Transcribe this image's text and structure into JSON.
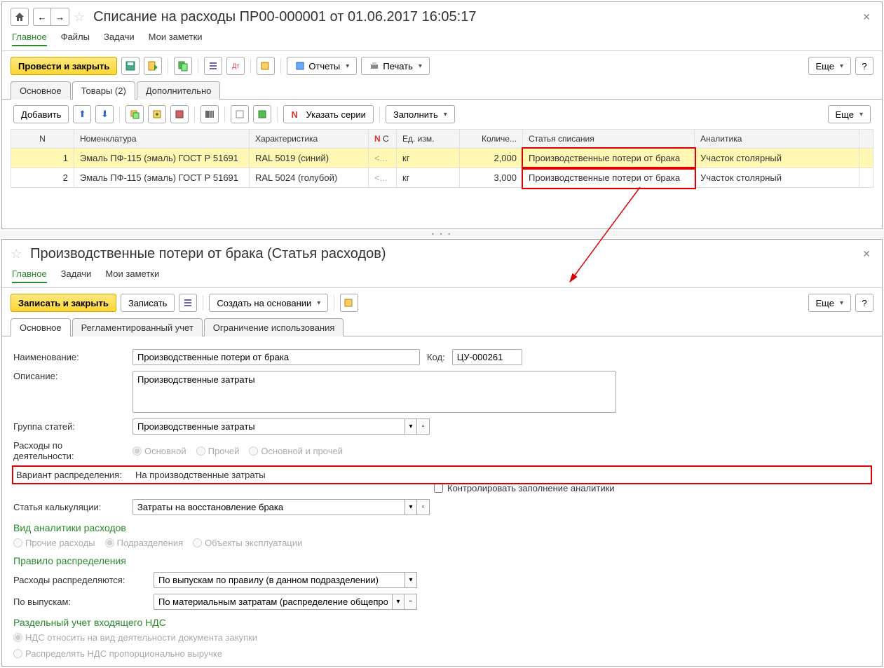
{
  "pane1": {
    "title": "Списание на расходы ПР00-000001 от 01.06.2017 16:05:17",
    "nav": [
      "Главное",
      "Файлы",
      "Задачи",
      "Мои заметки"
    ],
    "toolbar": {
      "post_close": "Провести и закрыть",
      "reports": "Отчеты",
      "print": "Печать",
      "more": "Еще"
    },
    "sub_tabs": [
      "Основное",
      "Товары (2)",
      "Дополнительно"
    ],
    "grid_toolbar": {
      "add": "Добавить",
      "series": "Указать серии",
      "fill": "Заполнить",
      "more": "Еще"
    },
    "table": {
      "headers": [
        "N",
        "Номенклатура",
        "Характеристика",
        "С",
        "Ед. изм.",
        "Количе...",
        "Статья списания",
        "Аналитика"
      ],
      "rows": [
        {
          "n": "1",
          "nom": "Эмаль ПФ-115 (эмаль) ГОСТ Р 51691",
          "char": "RAL 5019 (синий)",
          "c": "<...",
          "unit": "кг",
          "qty": "2,000",
          "article": "Производственные потери от брака",
          "anal": "Участок столярный"
        },
        {
          "n": "2",
          "nom": "Эмаль ПФ-115 (эмаль) ГОСТ Р 51691",
          "char": "RAL 5024 (голубой)",
          "c": "<...",
          "unit": "кг",
          "qty": "3,000",
          "article": "Производственные потери от брака",
          "anal": "Участок столярный"
        }
      ]
    }
  },
  "pane2": {
    "title": "Производственные потери от брака (Статья расходов)",
    "nav": [
      "Главное",
      "Задачи",
      "Мои заметки"
    ],
    "toolbar": {
      "save_close": "Записать и закрыть",
      "save": "Записать",
      "create_based": "Создать на основании",
      "more": "Еще"
    },
    "sub_tabs": [
      "Основное",
      "Регламентированный учет",
      "Ограничение использования"
    ],
    "form": {
      "name_lbl": "Наименование:",
      "name_val": "Производственные потери от брака",
      "code_lbl": "Код:",
      "code_val": "ЦУ-000261",
      "desc_lbl": "Описание:",
      "desc_val": "Производственные затраты",
      "group_lbl": "Группа статей:",
      "group_val": "Производственные затраты",
      "activity_lbl": "Расходы по деятельности:",
      "activity_opts": [
        "Основной",
        "Прочей",
        "Основной и прочей"
      ],
      "distrib_lbl": "Вариант распределения:",
      "distrib_val": "На производственные затраты",
      "control_chk": "Контролировать заполнение аналитики",
      "calc_lbl": "Статья калькуляции:",
      "calc_val": "Затраты на восстановление брака",
      "analytics_h": "Вид аналитики расходов",
      "analytics_opts": [
        "Прочие расходы",
        "Подразделения",
        "Объекты эксплуатации"
      ],
      "rule_h": "Правило распределения",
      "rule_lbl": "Расходы распределяются:",
      "rule_val": "По выпускам по правилу (в данном подразделении)",
      "by_output_lbl": "По выпускам:",
      "by_output_val": "По материальным затратам (распределение общепроизводс",
      "vat_h": "Раздельный учет входящего НДС",
      "vat_opts": [
        "НДС относить на вид деятельности документа закупки",
        "Распределять НДС пропорционально выручке"
      ]
    }
  }
}
